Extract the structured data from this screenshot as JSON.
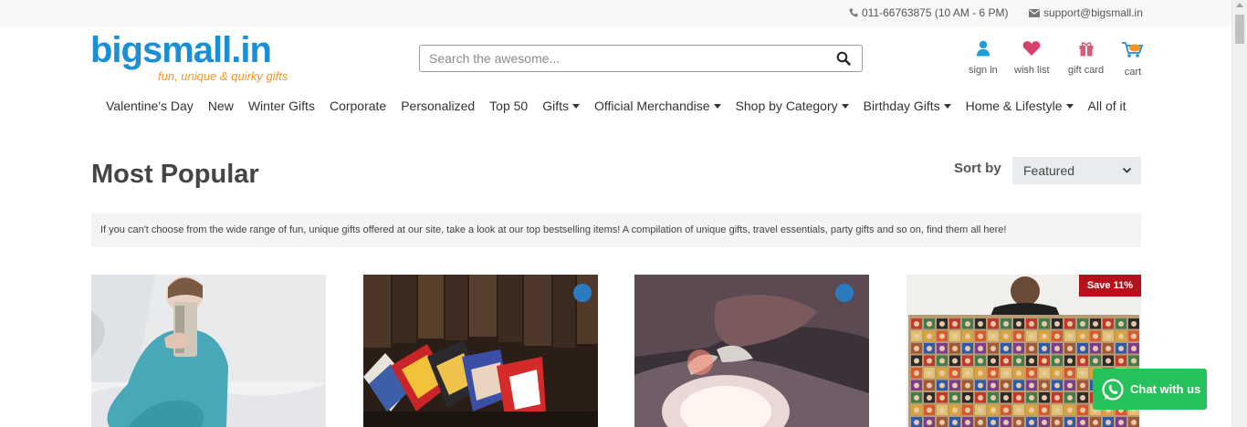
{
  "topbar": {
    "phone": "011-66763875 (10 AM - 6 PM)",
    "email": "support@bigsmall.in"
  },
  "logo": {
    "name": "bigsmall.in",
    "tagline": "fun, unique & quirky gifts"
  },
  "search": {
    "placeholder": "Search the awesome..."
  },
  "header_icons": {
    "sign_in": "sign in",
    "wish_list": "wish list",
    "gift_card": "gift card",
    "cart": "cart"
  },
  "nav": [
    {
      "label": "Valentine's Day",
      "dropdown": false
    },
    {
      "label": "New",
      "dropdown": false
    },
    {
      "label": "Winter Gifts",
      "dropdown": false
    },
    {
      "label": "Corporate",
      "dropdown": false
    },
    {
      "label": "Personalized",
      "dropdown": false
    },
    {
      "label": "Top 50",
      "dropdown": false
    },
    {
      "label": "Gifts",
      "dropdown": true
    },
    {
      "label": "Official Merchandise",
      "dropdown": true
    },
    {
      "label": "Shop by Category",
      "dropdown": true
    },
    {
      "label": "Birthday Gifts",
      "dropdown": true
    },
    {
      "label": "Home & Lifestyle",
      "dropdown": true
    },
    {
      "label": "All of it",
      "dropdown": false
    }
  ],
  "page": {
    "title": "Most Popular",
    "sort_label": "Sort by",
    "sort_value": "Featured",
    "intro": "If you can't choose from the wide range of fun, unique gifts offered at our site, take a look at our top bestselling items! A compilation of unique gifts, travel essentials, party gifts and so on, find them all here!"
  },
  "products": [
    {
      "image": "mermaid-blanket-photo",
      "badge": ""
    },
    {
      "image": "superhero-socks-photo",
      "badge": ""
    },
    {
      "image": "night-lamp-photo",
      "badge": ""
    },
    {
      "image": "superhero-poster-photo",
      "badge": "Save 11%"
    }
  ],
  "chat": {
    "label": "Chat with us"
  },
  "colors": {
    "brand_blue": "#1a8fd6",
    "brand_orange": "#f7941d",
    "chat_green": "#25c15b",
    "sale_red": "#b3121b"
  }
}
